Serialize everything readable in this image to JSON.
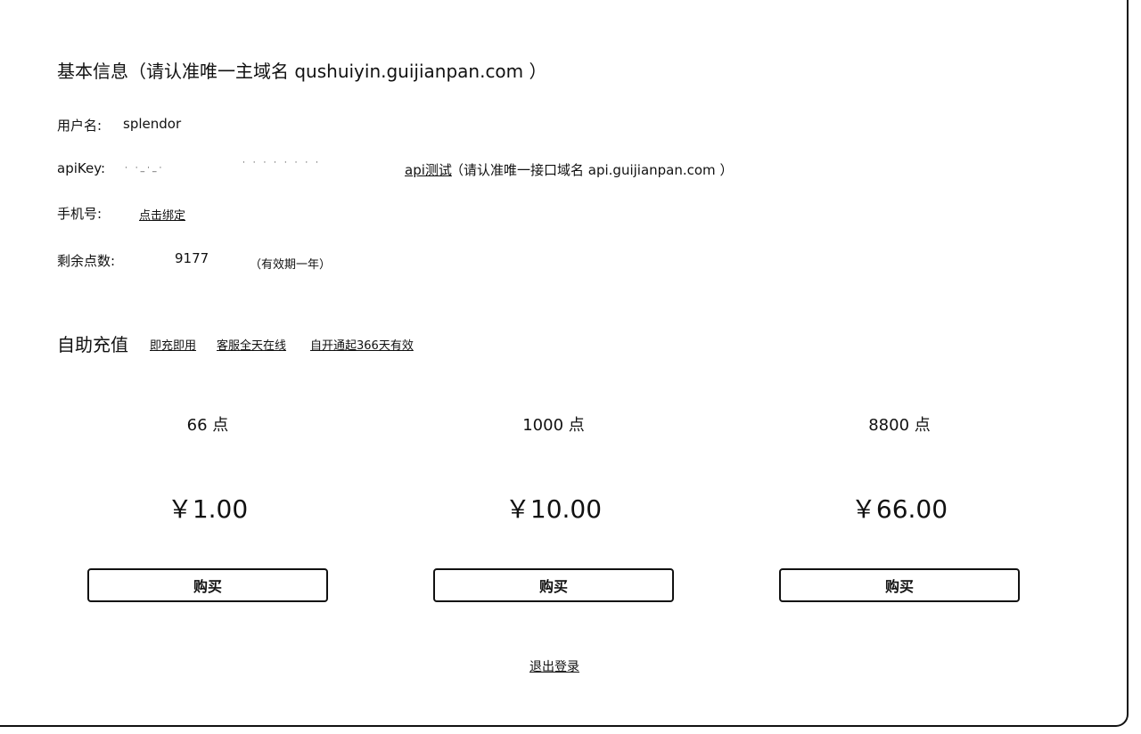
{
  "basic_info": {
    "title": "基本信息（请认准唯一主域名 qushuiyin.guijianpan.com ）"
  },
  "fields": {
    "username_label": "用户名:",
    "username_value": "splendor",
    "apikey_label": "apiKey:",
    "apikey_masked_1": "· ·_·_·",
    "apikey_masked_2": "·  ·  ·  ·  ·  ·  ·  ·",
    "api_test_link": "api测试",
    "api_domain_note": "（请认准唯一接口域名 api.guijianpan.com ）",
    "phone_label": "手机号:",
    "phone_bind_link": "点击绑定",
    "points_label": "剩余点数:",
    "points_value": "9177",
    "points_validity": "（有效期一年）"
  },
  "recharge": {
    "title": "自助充值",
    "links": [
      "即充即用",
      "客服全天在线",
      "自开通起366天有效"
    ]
  },
  "plans": [
    {
      "points": "66 点",
      "price": "￥1.00",
      "button": "购买"
    },
    {
      "points": "1000 点",
      "price": "￥10.00",
      "button": "购买"
    },
    {
      "points": "8800 点",
      "price": "￥66.00",
      "button": "购买"
    }
  ],
  "logout_label": "退出登录"
}
